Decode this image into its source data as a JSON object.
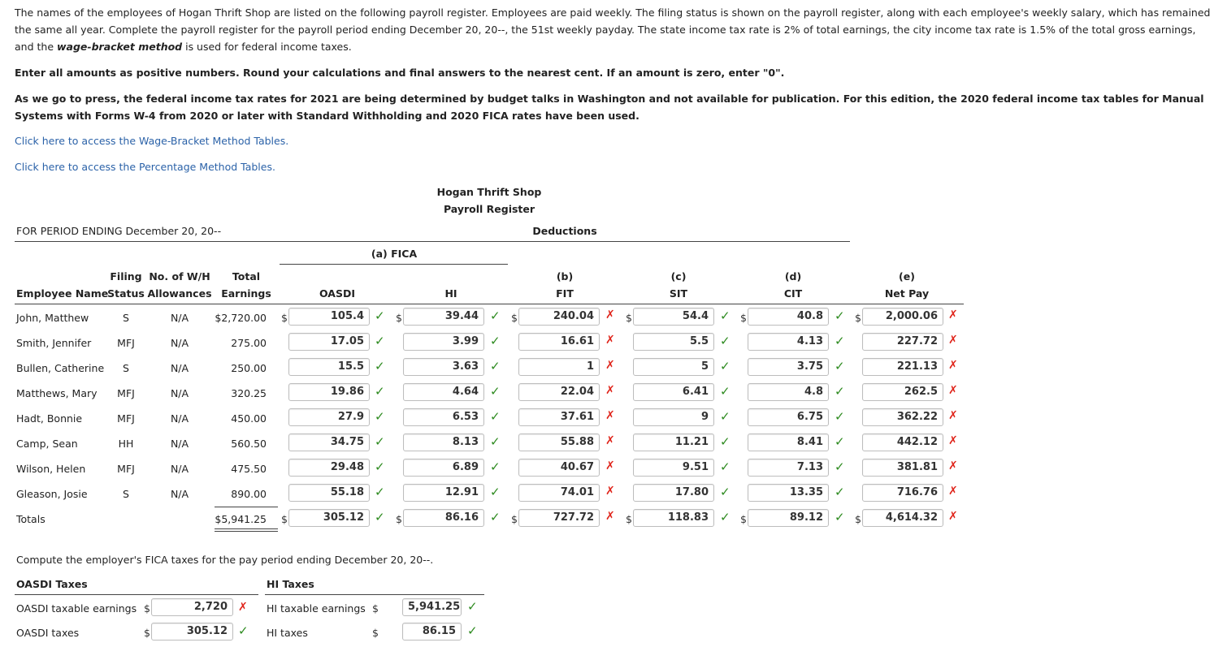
{
  "instructions": {
    "p1_a": "The names of the employees of Hogan Thrift Shop are listed on the following payroll register. Employees are paid weekly. The filing status is shown on the payroll register, along with each employee's weekly salary, which has remained the same all year. Complete the payroll register for the payroll period ending December 20, 20--, the 51st weekly payday. The state income tax rate is 2% of total earnings, the city income tax rate is 1.5% of the total gross earnings, and the ",
    "p1_b": "wage-bracket method",
    "p1_c": " is used for federal income taxes.",
    "p2": "Enter all amounts as positive numbers. Round your calculations and final answers to the nearest cent. If an amount is zero, enter \"0\".",
    "p3": "As we go to press, the federal income tax rates for 2021 are being determined by budget talks in Washington and not available for publication. For this edition, the 2020 federal income tax tables for Manual Systems with Forms W-4 from 2020 or later with Standard Withholding and 2020 FICA rates have been used.",
    "link1": "Click here to access the Wage-Bracket Method Tables.",
    "link2": "Click here to access the Percentage Method Tables."
  },
  "register": {
    "company": "Hogan Thrift Shop",
    "title": "Payroll Register",
    "period": "FOR PERIOD ENDING December 20, 20--",
    "deductions": "Deductions",
    "fica": "(a) FICA",
    "headers": {
      "filing_1": "Filing",
      "filing_2": "Status",
      "wh_1": "No. of W/H",
      "wh_2": "Allowances",
      "total_1": "Total",
      "total_2": "Earnings",
      "name": "Employee Name",
      "oasdi": "OASDI",
      "hi": "HI",
      "fit_1": "(b)",
      "fit_2": "FIT",
      "sit_1": "(c)",
      "sit_2": "SIT",
      "cit_1": "(d)",
      "cit_2": "CIT",
      "net_1": "(e)",
      "net_2": "Net Pay"
    },
    "rows": [
      {
        "name": "John, Matthew",
        "status": "S",
        "allow": "N/A",
        "earn": "$2,720.00",
        "oasdi": "105.4",
        "hi": "39.44",
        "fit": "240.04",
        "sit": "54.4",
        "cit": "40.8",
        "net": "2,000.06",
        "oasdi_ok": true,
        "hi_ok": true,
        "fit_ok": false,
        "sit_ok": true,
        "cit_ok": true,
        "net_ok": false
      },
      {
        "name": "Smith, Jennifer",
        "status": "MFJ",
        "allow": "N/A",
        "earn": "275.00",
        "oasdi": "17.05",
        "hi": "3.99",
        "fit": "16.61",
        "sit": "5.5",
        "cit": "4.13",
        "net": "227.72",
        "oasdi_ok": true,
        "hi_ok": true,
        "fit_ok": false,
        "sit_ok": true,
        "cit_ok": true,
        "net_ok": false
      },
      {
        "name": "Bullen, Catherine",
        "status": "S",
        "allow": "N/A",
        "earn": "250.00",
        "oasdi": "15.5",
        "hi": "3.63",
        "fit": "1",
        "sit": "5",
        "cit": "3.75",
        "net": "221.13",
        "oasdi_ok": true,
        "hi_ok": true,
        "fit_ok": false,
        "sit_ok": true,
        "cit_ok": true,
        "net_ok": false
      },
      {
        "name": "Matthews, Mary",
        "status": "MFJ",
        "allow": "N/A",
        "earn": "320.25",
        "oasdi": "19.86",
        "hi": "4.64",
        "fit": "22.04",
        "sit": "6.41",
        "cit": "4.8",
        "net": "262.5",
        "oasdi_ok": true,
        "hi_ok": true,
        "fit_ok": false,
        "sit_ok": true,
        "cit_ok": true,
        "net_ok": false
      },
      {
        "name": "Hadt, Bonnie",
        "status": "MFJ",
        "allow": "N/A",
        "earn": "450.00",
        "oasdi": "27.9",
        "hi": "6.53",
        "fit": "37.61",
        "sit": "9",
        "cit": "6.75",
        "net": "362.22",
        "oasdi_ok": true,
        "hi_ok": true,
        "fit_ok": false,
        "sit_ok": true,
        "cit_ok": true,
        "net_ok": false
      },
      {
        "name": "Camp, Sean",
        "status": "HH",
        "allow": "N/A",
        "earn": "560.50",
        "oasdi": "34.75",
        "hi": "8.13",
        "fit": "55.88",
        "sit": "11.21",
        "cit": "8.41",
        "net": "442.12",
        "oasdi_ok": true,
        "hi_ok": true,
        "fit_ok": false,
        "sit_ok": true,
        "cit_ok": true,
        "net_ok": false
      },
      {
        "name": "Wilson, Helen",
        "status": "MFJ",
        "allow": "N/A",
        "earn": "475.50",
        "oasdi": "29.48",
        "hi": "6.89",
        "fit": "40.67",
        "sit": "9.51",
        "cit": "7.13",
        "net": "381.81",
        "oasdi_ok": true,
        "hi_ok": true,
        "fit_ok": false,
        "sit_ok": true,
        "cit_ok": true,
        "net_ok": false
      },
      {
        "name": "Gleason, Josie",
        "status": "S",
        "allow": "N/A",
        "earn": "890.00",
        "oasdi": "55.18",
        "hi": "12.91",
        "fit": "74.01",
        "sit": "17.80",
        "cit": "13.35",
        "net": "716.76",
        "oasdi_ok": true,
        "hi_ok": true,
        "fit_ok": false,
        "sit_ok": true,
        "cit_ok": true,
        "net_ok": false
      }
    ],
    "totals": {
      "label": "Totals",
      "earn": "$5,941.25",
      "oasdi": "305.12",
      "hi": "86.16",
      "fit": "727.72",
      "sit": "118.83",
      "cit": "89.12",
      "net": "4,614.32",
      "oasdi_ok": true,
      "hi_ok": true,
      "fit_ok": false,
      "sit_ok": true,
      "cit_ok": true,
      "net_ok": false
    }
  },
  "employer": {
    "prompt": "Compute the employer's FICA taxes for the pay period ending December 20, 20--.",
    "oasdi_title": "OASDI Taxes",
    "hi_title": "HI Taxes",
    "oasdi_earn_label": "OASDI taxable earnings",
    "oasdi_earn": "2,720",
    "oasdi_earn_ok": false,
    "oasdi_tax_label": "OASDI taxes",
    "oasdi_tax": "305.12",
    "oasdi_tax_ok": true,
    "hi_earn_label": "HI taxable earnings",
    "hi_earn": "5,941.25",
    "hi_earn_ok": true,
    "hi_tax_label": "HI taxes",
    "hi_tax": "86.15",
    "hi_tax_ok": true
  },
  "symbols": {
    "dollar": "$",
    "check": "✓",
    "cross": "✗"
  },
  "colors": {
    "link": "#2b62a8",
    "check": "#2e8b20",
    "cross": "#e0251b"
  }
}
